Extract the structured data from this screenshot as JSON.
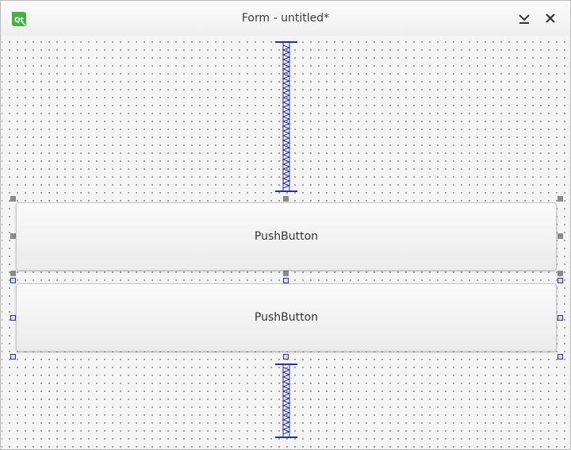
{
  "window": {
    "title": "Form - untitled*",
    "app_icon": "qt-designer-icon",
    "controls": [
      "chevron-down-icon",
      "close-icon"
    ]
  },
  "form": {
    "buttons": [
      {
        "label": "PushButton",
        "selected": false
      },
      {
        "label": "PushButton",
        "selected": true
      }
    ],
    "spacers": [
      "vertical-spacer",
      "vertical-spacer"
    ]
  },
  "colors": {
    "selection_handle": "#2a2fa6",
    "inactive_handle": "#8a8a8a",
    "spacer": "#2a2fa6"
  }
}
